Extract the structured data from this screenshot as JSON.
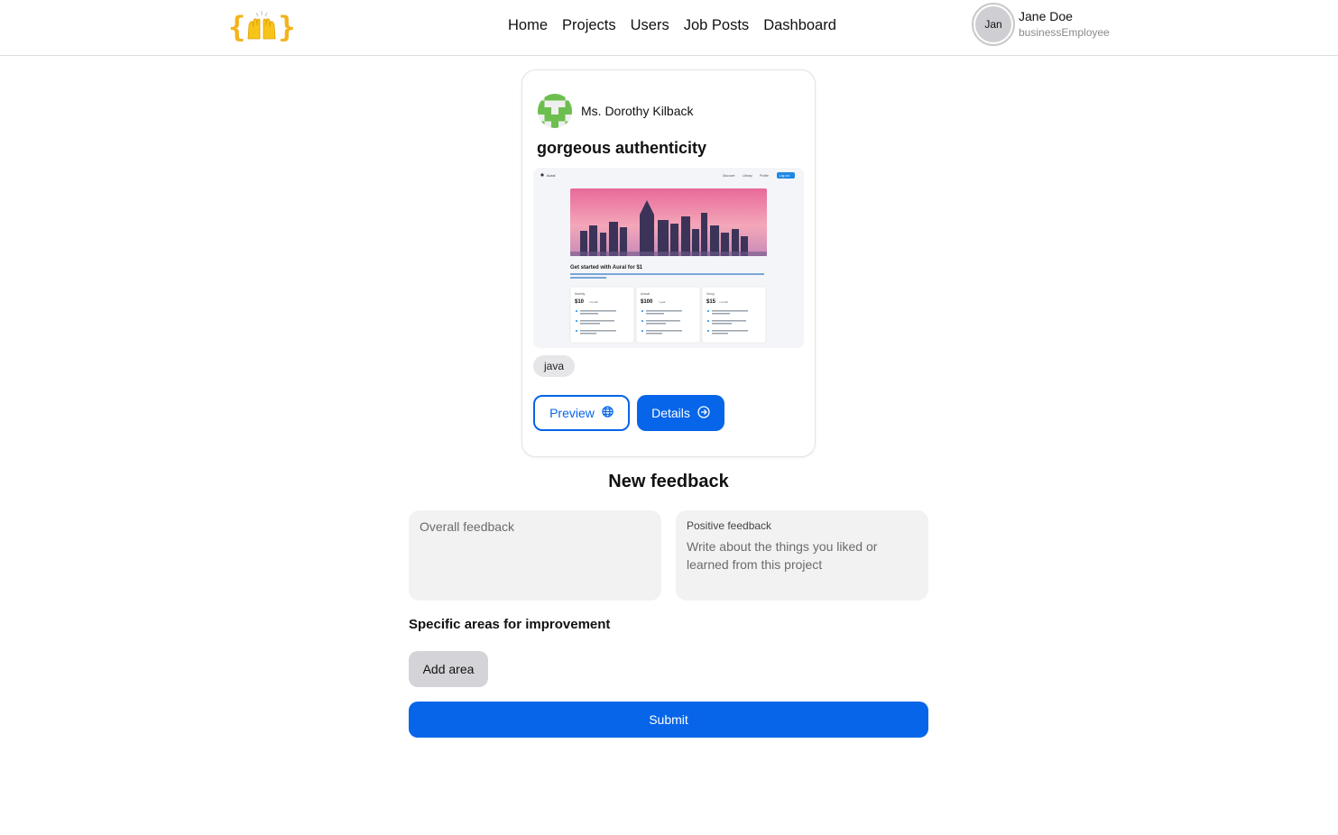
{
  "header": {
    "logo_left_brace": "{",
    "logo_right_brace": "}",
    "logo_icon": "raising-hands-emoji",
    "nav": [
      {
        "label": "Home"
      },
      {
        "label": "Projects"
      },
      {
        "label": "Users"
      },
      {
        "label": "Job Posts"
      },
      {
        "label": "Dashboard"
      }
    ],
    "user": {
      "avatar_text": "Jan",
      "name": "Jane Doe",
      "role": "businessEmployee"
    }
  },
  "project_card": {
    "author_name": "Ms. Dorothy Kilback",
    "author_avatar_icon": "identicon",
    "title": "gorgeous authenticity",
    "tag": "java",
    "preview_button": {
      "label": "Preview",
      "icon": "globe-icon"
    },
    "details_button": {
      "label": "Details",
      "icon": "arrow-right-circle-icon"
    },
    "screenshot": {
      "brand": "Aural",
      "nav": [
        "Discover",
        "Library",
        "Profile"
      ],
      "cta": "Log out",
      "headline": "Get started with Aural for $1",
      "plans": [
        {
          "name": "Monthly",
          "price": "$10",
          "period": "/ month"
        },
        {
          "name": "Annual",
          "price": "$100",
          "period": "/ year"
        },
        {
          "name": "Group",
          "price": "$15",
          "period": "/ month"
        }
      ]
    }
  },
  "feedback": {
    "title": "New feedback",
    "overall_placeholder": "Overall feedback",
    "positive_label": "Positive feedback",
    "positive_placeholder": "Write about the things you liked or learned from this project",
    "areas_title": "Specific areas for improvement",
    "add_area_label": "Add area",
    "submit_label": "Submit"
  },
  "colors": {
    "primary": "#0665e8",
    "logo": "#f2b31a",
    "identicon": "#6cbf4f"
  }
}
